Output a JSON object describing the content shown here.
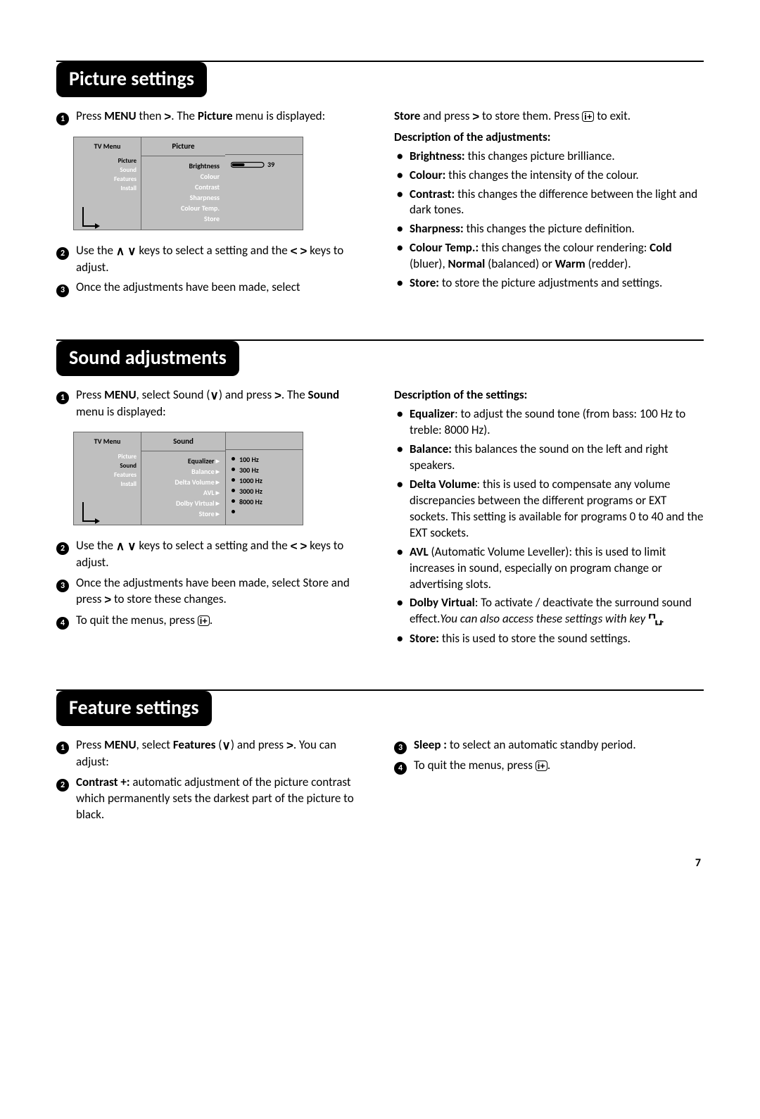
{
  "page_number": "7",
  "sections": {
    "picture": {
      "title": "Picture settings",
      "steps_left": {
        "s1_a": "Press ",
        "s1_menu": "MENU",
        "s1_b": " then ",
        "s1_c": ". The ",
        "s1_picture": "Picture",
        "s1_d": " menu is displayed:",
        "s2_a": "Use the ",
        "s2_b": " keys to select a setting and the ",
        "s2_c": " keys to adjust.",
        "s3": "Once the adjustments have been made, select "
      },
      "right": {
        "store_a": "Store",
        "store_b": " and press ",
        "store_c": " to store them. Press ",
        "store_d": " to exit.",
        "info_key": "i+",
        "desc_title": "Description of the adjustments:",
        "items": [
          {
            "term": "Brightness:",
            "text": " this changes picture brilliance."
          },
          {
            "term": "Colour:",
            "text": " this changes the intensity of the colour."
          },
          {
            "term": "Contrast:",
            "text": " this changes the difference between the light and dark tones."
          },
          {
            "term": "Sharpness:",
            "text": " this changes the picture definition."
          },
          {
            "term": "Colour Temp.:",
            "text": " this changes the colour rendering: ",
            "bold1": "Cold",
            "mid1": " (bluer), ",
            "bold2": "Normal",
            "mid2": " (balanced) or ",
            "bold3": "Warm",
            "tail": " (redder)."
          },
          {
            "term": "Store:",
            "text": " to store the picture adjustments and settings."
          }
        ]
      },
      "menu": {
        "left_title": "TV Menu",
        "left_items": [
          "Picture",
          "Sound",
          "Features",
          "Install"
        ],
        "left_selected_index": 0,
        "mid_title": "Picture",
        "mid_items": [
          "Brightness",
          "Colour",
          "Contrast",
          "Sharpness",
          "Colour Temp.",
          "Store"
        ],
        "mid_selected_index": 0,
        "slider_value": "39"
      }
    },
    "sound": {
      "title": "Sound adjustments",
      "steps_left": {
        "s1_a": "Press ",
        "s1_menu": "MENU",
        "s1_b": ", select Sound (",
        "s1_c": ") and press ",
        "s1_d": ". The ",
        "s1_sound": "Sound",
        "s1_e": " menu is displayed:",
        "s2_a": "Use the ",
        "s2_b": " keys to select a setting and the ",
        "s2_c": " keys to adjust.",
        "s3_a": "Once the adjustments have been made, select Store and press ",
        "s3_b": " to store these changes.",
        "s4_a": "To quit the menus, press ",
        "s4_b": ".",
        "info_key": "i+"
      },
      "right": {
        "desc_title": "Description of the settings:",
        "items": {
          "eq_term": "Equalizer",
          "eq_text": ": to adjust the sound tone (from bass: 100 Hz to treble: 8000 Hz).",
          "bal_term": "Balance:",
          "bal_text": " this balances the sound on the left and right speakers.",
          "delta_term": "Delta Volume",
          "delta_text": ": this is used to compensate any volume discrepancies between the different programs or EXT sockets. This setting is available for programs 0 to 40 and the EXT sockets.",
          "avl_term": "AVL",
          "avl_text": " (Automatic Volume Leveller): this is used to limit increases in sound, especially on program change or advertising slots.",
          "dolby_term": "Dolby Virtual",
          "dolby_text": ": To activate / deactivate the surround sound effect.",
          "dolby_italic": "You can also access these settings with key ",
          "dolby_tail": ".",
          "store_term": "Store:",
          "store_text": " this is used to store the sound settings."
        }
      },
      "menu": {
        "left_title": "TV Menu",
        "left_items": [
          "Picture",
          "Sound",
          "Features",
          "Install"
        ],
        "left_selected_index": 1,
        "mid_title": "Sound",
        "mid_items": [
          "Equalizer",
          "Balance",
          "Delta Volume",
          "AVL",
          "Dolby Virtual",
          "Store"
        ],
        "mid_selected_index": 0,
        "right_items": [
          "100 Hz",
          "300 Hz",
          "1000 Hz",
          "3000 Hz",
          "8000 Hz",
          ""
        ]
      }
    },
    "features": {
      "title": "Feature settings",
      "left": {
        "s1_a": "Press ",
        "s1_menu": "MENU",
        "s1_b": ", select ",
        "s1_features": "Features",
        "s1_c": " (",
        "s1_d": ") and press ",
        "s1_e": ". You can adjust:",
        "s2_term": "Contrast +:",
        "s2_text": " automatic adjustment of the picture contrast which permanently sets the darkest part of the picture to black."
      },
      "right": {
        "s3_term": "Sleep :",
        "s3_text": " to select an automatic standby period.",
        "s4_a": "To quit the menus, press ",
        "s4_b": ".",
        "info_key": "i+"
      }
    }
  }
}
